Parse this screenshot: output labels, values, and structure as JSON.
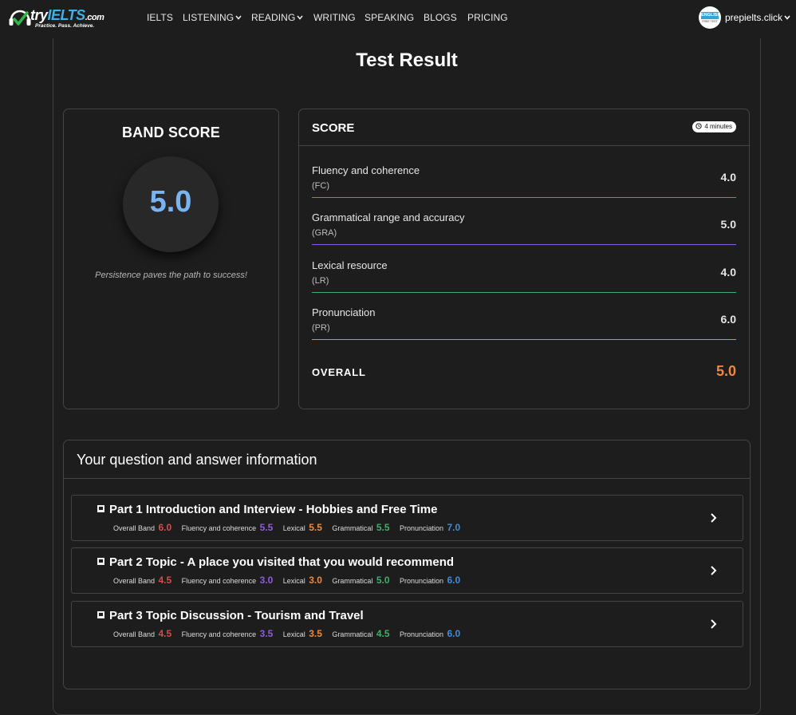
{
  "navbar": {
    "logo": {
      "text_prefix": "try",
      "text_brand": "IELTS",
      "text_domain": ".com",
      "tagline": "Practice. Pass. Achieve."
    },
    "links": [
      {
        "label": "IELTS",
        "dropdown": false
      },
      {
        "label": "LISTENING",
        "dropdown": true
      },
      {
        "label": "READING",
        "dropdown": true
      },
      {
        "label": "WRITING",
        "dropdown": false
      },
      {
        "label": "SPEAKING",
        "dropdown": false
      },
      {
        "label": "BLOGS",
        "dropdown": false
      },
      {
        "label": "PRICING",
        "dropdown": false
      }
    ],
    "user": {
      "avatar_top": "ENGLISH",
      "avatar_bottom": "FREE TEST",
      "name": "prepielts.click",
      "menu_icon": "chevron-down-icon"
    }
  },
  "page_title": "Test Result",
  "band": {
    "title": "BAND SCORE",
    "value": "5.0",
    "quote": "Persistence paves the path to success!"
  },
  "score": {
    "title": "SCORE",
    "time": "4 minutes",
    "time_icon": "clock-icon",
    "criteria": [
      {
        "name": "Fluency and coherence",
        "abbr": "(FC)",
        "score": "4.0",
        "color": "#e0604a"
      },
      {
        "name": "Grammatical range and accuracy",
        "abbr": "(GRA)",
        "score": "5.0",
        "color": "#8e5ce0"
      },
      {
        "name": "Lexical resource",
        "abbr": "(LR)",
        "score": "4.0",
        "color": "#3fae6a"
      },
      {
        "name": "Pronunciation",
        "abbr": "(PR)",
        "score": "6.0",
        "color": "#f08a3a"
      }
    ],
    "overall_label": "OVERALL",
    "overall_value": "5.0"
  },
  "qa": {
    "title": "Your question and answer information",
    "score_labels": {
      "overall": "Overall Band",
      "fc": "Fluency and coherence",
      "lexical": "Lexical",
      "grammatical": "Grammatical",
      "pronunciation": "Pronunciation"
    },
    "score_colors": {
      "overall": "#e04848",
      "fc": "#8e5ce0",
      "lexical": "#f08a3a",
      "grammatical": "#3fae6a",
      "pronunciation": "#3a8ee0"
    },
    "parts": [
      {
        "title": "Part 1 Introduction and Interview - Hobbies and Free Time",
        "overall": "6.0",
        "fc": "5.5",
        "lexical": "5.5",
        "grammatical": "5.5",
        "pronunciation": "7.0"
      },
      {
        "title": "Part 2 Topic - A place you visited that you would recommend",
        "overall": "4.5",
        "fc": "3.0",
        "lexical": "3.0",
        "grammatical": "5.0",
        "pronunciation": "6.0"
      },
      {
        "title": "Part 3 Topic Discussion - Tourism and Travel",
        "overall": "4.5",
        "fc": "3.5",
        "lexical": "3.5",
        "grammatical": "4.5",
        "pronunciation": "6.0"
      }
    ]
  }
}
